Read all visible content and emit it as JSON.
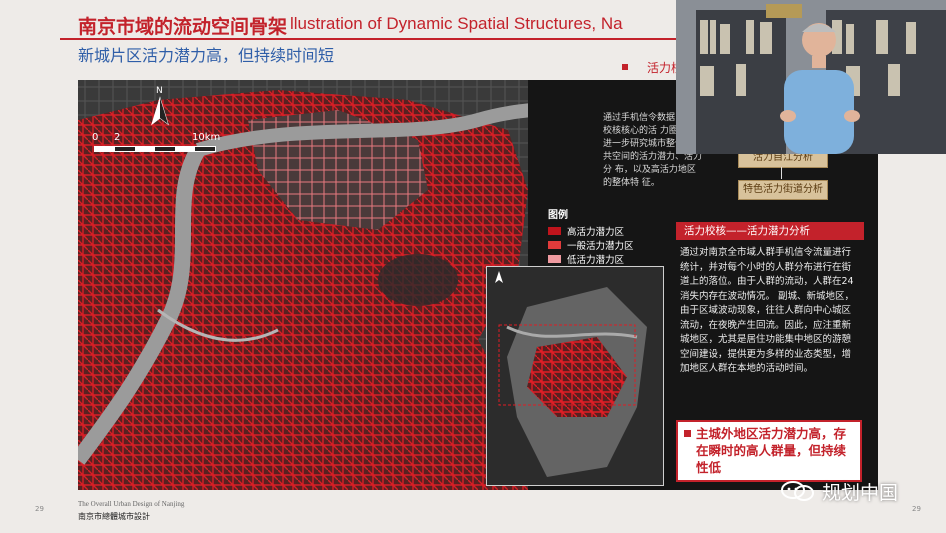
{
  "slide": {
    "title_zh": "南京市域的流动空间骨架",
    "title_en": "llustration of Dynamic Spatial Structures,   Na",
    "subtitle": "新城片区活力潜力高，但持续时间短",
    "tag": "活力校"
  },
  "map": {
    "north_label": "N",
    "scale_labels": [
      "0",
      "2",
      "10km"
    ],
    "overlay_note": "通过手机信令数据 除了校核核心的活 力圈层，进一步研究城市整体 公共空间的活力潜力、活力分 布，以及高活力地区的整体特 征。"
  },
  "legend": {
    "title": "图例",
    "items": [
      {
        "label": "高活力潜力区",
        "color": "#c0141c"
      },
      {
        "label": "一般活力潜力区",
        "color": "#e23b3b"
      },
      {
        "label": "低活力潜力区",
        "color": "#ef9aa0"
      }
    ]
  },
  "flow": {
    "node_top": "活力自江分析",
    "node_bottom": "特色活力街道分析"
  },
  "analysis": {
    "heading": "活力校核——活力潜力分析",
    "body": "通过对南京全市域人群手机信令流量进行统计，并对每个小时的人群分布进行在街道上的落位。由于人群的流动，人群在24消失内存在波动情况。 副城、新城地区，由于区域波动现象，往往人群向中心城区流动，在夜晚产生回流。因此，应注重新城地区，尤其是居住功能集中地区的游憩空间建设，提供更为多样的业态类型，增加地区人群在本地的活动时间。"
  },
  "callout": {
    "text": "主城外地区活力潜力高，存在瞬时的高人群量，但持续性低"
  },
  "footer": {
    "en": "The Overall Urban Design of Nanjing",
    "zh": "南京市總體城市設計",
    "page_left": "29",
    "page_right": "29"
  },
  "watermark": {
    "text": "规划中国"
  },
  "colors": {
    "accent_red": "#c3222b",
    "title_blue": "#2f5ea8",
    "panel_dark": "#1b1b1b"
  }
}
